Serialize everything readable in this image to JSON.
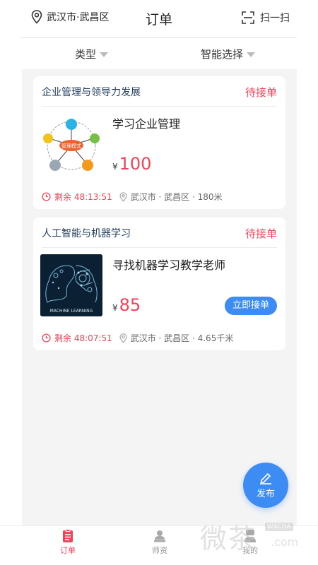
{
  "header": {
    "location": "武汉市·武昌区",
    "title": "订单",
    "scan_label": "扫一扫",
    "location_icon": "location-pin-icon",
    "scan_icon": "scan-frame-icon"
  },
  "filters": {
    "type_label": "类型",
    "smart_label": "智能选择"
  },
  "orders": [
    {
      "category": "企业管理与领导力发展",
      "status": "待接单",
      "title": "学习企业管理",
      "currency": "¥",
      "price": "100",
      "remaining": "剩余 48:13:51",
      "place": "武汉市 · 武昌区 · 180米",
      "thumb_center_label": "管理模式"
    },
    {
      "category": "人工智能与机器学习",
      "status": "待接单",
      "title": "寻找机器学习教学老师",
      "currency": "¥",
      "price": "85",
      "accept_button": "立即接单",
      "remaining": "剩余 48:07:51",
      "place": "武汉市 · 武昌区 · 4.65千米",
      "thumb_caption": "MACHINE LEARNING"
    }
  ],
  "fab": {
    "label": "发布",
    "icon": "pencil-icon"
  },
  "tabbar": {
    "items": [
      {
        "label": "订单",
        "active": true,
        "icon": "document-icon"
      },
      {
        "label": "师资",
        "active": false,
        "icon": "teacher-icon"
      },
      {
        "label": "我的",
        "active": false,
        "icon": "user-icon"
      }
    ]
  },
  "colors": {
    "accent_red": "#f0445a",
    "accent_blue": "#3d8cf4",
    "background": "#f4f4f5"
  },
  "watermark": {
    "main": "微茶",
    "small": "WXCHA",
    "domain": ".com"
  }
}
